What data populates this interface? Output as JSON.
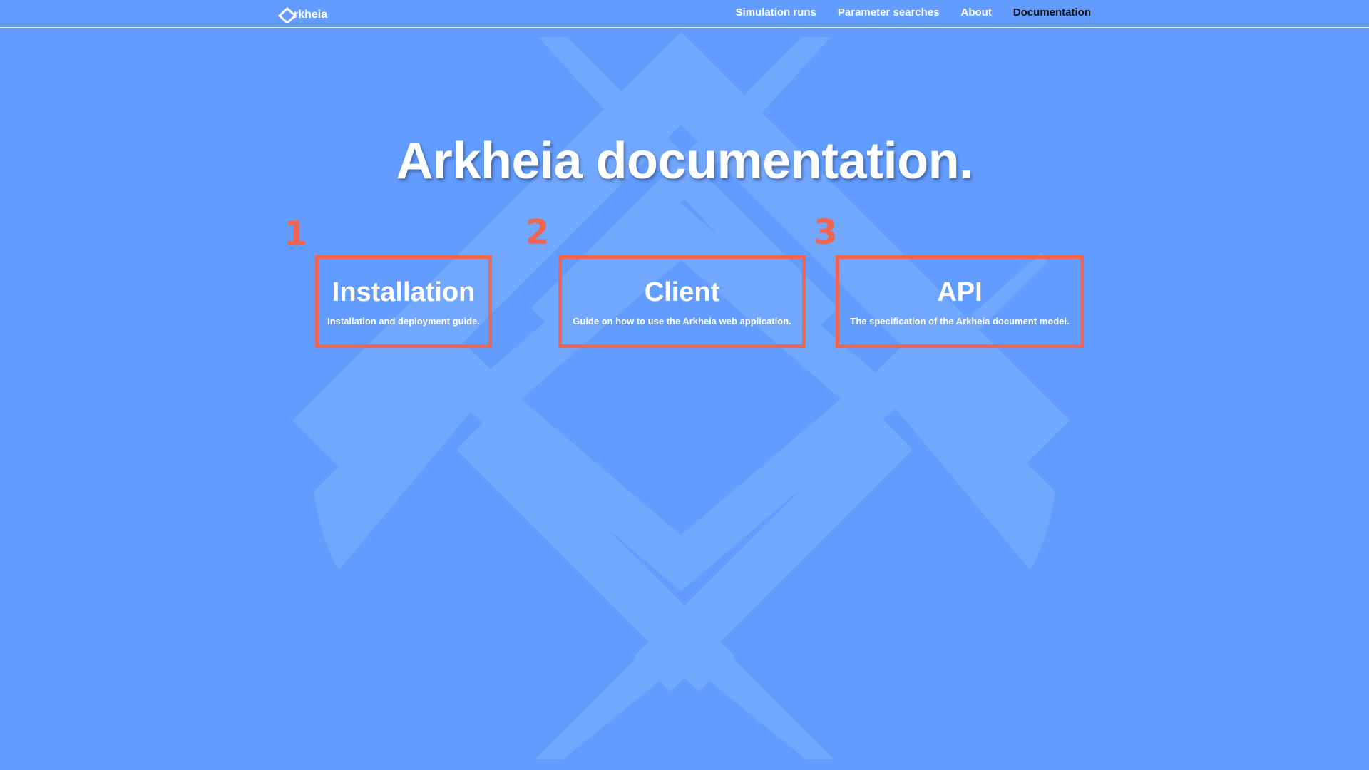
{
  "nav": {
    "brand": "rkheia",
    "links": [
      {
        "label": "Simulation runs"
      },
      {
        "label": "Parameter searches"
      },
      {
        "label": "About"
      },
      {
        "label": "Documentation",
        "active": true
      }
    ]
  },
  "hero": {
    "title": "Arkheia documentation."
  },
  "cards": [
    {
      "marker": "1",
      "title": "Installation",
      "description": "Installation and deployment guide."
    },
    {
      "marker": "2",
      "title": "Client",
      "description": "Guide on how to use the Arkheia web application."
    },
    {
      "marker": "3",
      "title": "API",
      "description": "The specification of the Arkheia document model."
    }
  ],
  "colors": {
    "background": "#619cfe",
    "emblem": "#76a9ff",
    "annotation": "#ee6651",
    "nav_active": "#111111"
  }
}
